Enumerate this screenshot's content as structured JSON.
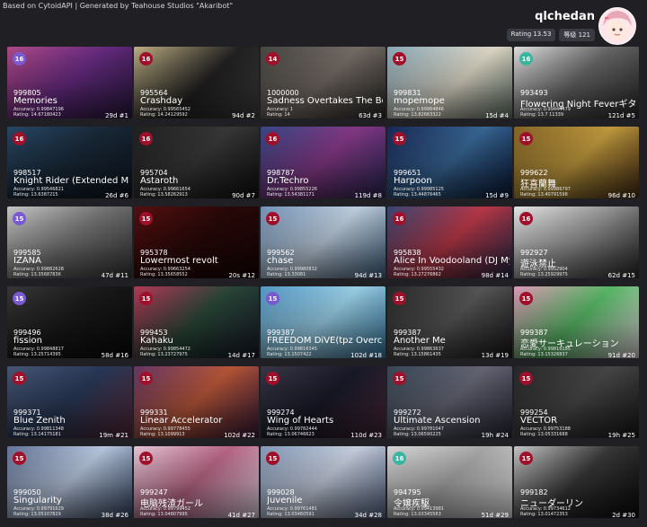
{
  "header": {
    "credit": "Based on CytoidAPI | Generated by Teahouse Studios \"Akaribot\"",
    "username": "qlchedan",
    "rating_label": "Rating 13.53",
    "level_label": "等级 121"
  },
  "colors": {
    "badge_red": "#a0102a",
    "badge_purple": "#7a5ad0",
    "badge_teal": "#38b6a0"
  },
  "cards": [
    {
      "level": "16",
      "lvc": "#7a5ad0",
      "score": "999805",
      "title": "Memories",
      "acc": "Accuracy: 0.99847196",
      "rating": "Rating: 14.67180423",
      "rank": "29d #1",
      "bg": "linear-gradient(135deg,#b84d8c,#6a2c86 50%,#2a1a40)"
    },
    {
      "level": "16",
      "lvc": "#a0102a",
      "score": "995564",
      "title": "Crashday",
      "acc": "Accuracy: 0.99565452",
      "rating": "Rating: 14.24129592",
      "rank": "94d #2",
      "bg": "linear-gradient(135deg,#c7b78a,#222 55%,#444)"
    },
    {
      "level": "14",
      "lvc": "#a0102a",
      "score": "1000000",
      "title": "Sadness Overtakes The Body",
      "acc": "Accuracy: 1",
      "rating": "Rating: 14",
      "rank": "63d #3",
      "bg": "linear-gradient(135deg,#4a4a46,#7a706a 50%,#2d2d2a)"
    },
    {
      "level": "15",
      "lvc": "#a0102a",
      "score": "999831",
      "title": "mopemope",
      "acc": "Accuracy: 0.99964846",
      "rating": "Rating: 13.82663322",
      "rank": "15d #4",
      "bg": "linear-gradient(135deg,#8fb0c0,#e8e2d0 55%,#6a7c70)"
    },
    {
      "level": "16",
      "lvc": "#38b6a0",
      "score": "993493",
      "title": "Flowering Night Feverギターイン",
      "acc": "Accuracy: 0.99444479",
      "rating": "Rating: 13.7 11339",
      "rank": "121d #5",
      "bg": "linear-gradient(135deg,#eaeaea,#6a6a6a 50%,#2a2a2a)"
    },
    {
      "level": "16",
      "lvc": "#a0102a",
      "score": "998517",
      "title": "Knight Rider (Extended Mix)",
      "acc": "Accuracy: 0.99546821",
      "rating": "Rating: 13.6387215",
      "rank": "26d #6",
      "bg": "linear-gradient(135deg,#2a4a6a,#1a2a3a 50%,#0e1620)"
    },
    {
      "level": "16",
      "lvc": "#a0102a",
      "score": "995704",
      "title": "Astaroth",
      "acc": "Accuracy: 0.99661654",
      "rating": "Rating: 13.58262913",
      "rank": "90d #7",
      "bg": "linear-gradient(135deg,#222,#3a3a3a 50%,#111)"
    },
    {
      "level": "16",
      "lvc": "#a0102a",
      "score": "998787",
      "title": "Dr.Techro",
      "acc": "Accuracy: 0.99855226",
      "rating": "Rating: 13.54381171",
      "rank": "119d #8",
      "bg": "linear-gradient(135deg,#3a4a8a,#8a3a8a 50%,#2a2a5a)"
    },
    {
      "level": "15",
      "lvc": "#a0102a",
      "score": "999651",
      "title": "Harpoon",
      "acc": "Accuracy: 0.99985125",
      "rating": "Rating: 13.44876465",
      "rank": "15d #9",
      "bg": "linear-gradient(135deg,#1a2a5a,#3a6a9a 50%,#0a1a3a)"
    },
    {
      "level": "15",
      "lvc": "#a0102a",
      "score": "999622",
      "title": "狂喜蘭舞",
      "acc": "Accuracy: 0.99986797",
      "rating": "Rating: 13.40791598",
      "rank": "96d #10",
      "bg": "linear-gradient(135deg,#8a6a2a,#c8a040 50%,#4a3015)"
    },
    {
      "level": "15",
      "lvc": "#7a5ad0",
      "score": "999585",
      "title": "IZANA",
      "acc": "Accuracy: 0.99882628",
      "rating": "Rating: 13.35687836",
      "rank": "47d #11",
      "bg": "linear-gradient(135deg,#d0d0d0,#7a7a7a 50%,#3a3a3a)"
    },
    {
      "level": "15",
      "lvc": "#a0102a",
      "score": "995378",
      "title": "Lowermost revolt",
      "acc": "Accuracy: 0.99663254",
      "rating": "Rating: 13.35658552",
      "rank": "20s #12",
      "bg": "linear-gradient(135deg,#5a1010,#2a0808 50%,#1a0505)"
    },
    {
      "level": "15",
      "lvc": "#a0102a",
      "score": "999562",
      "title": "chase",
      "acc": "Accuracy: 0.99980832",
      "rating": "Rating: 13.33081",
      "rank": "94d #13",
      "bg": "linear-gradient(135deg,#7a9ac0,#c8d8e8 50%,#4a6a8a)"
    },
    {
      "level": "16",
      "lvc": "#a0102a",
      "score": "995838",
      "title": "Alice In Voodooland (DJ Myosuke",
      "acc": "Accuracy: 0.99555432",
      "rating": "Rating: 13.27276862",
      "rank": "98d #14",
      "bg": "linear-gradient(135deg,#3a4a7a,#c03a4a 50%,#2a2a4a)"
    },
    {
      "level": "16",
      "lvc": "#a0102a",
      "score": "992927",
      "title": "遊泳禁止",
      "acc": "Accuracy: 0.9952904",
      "rating": "Rating: 13.25929975",
      "rank": "62d #15",
      "bg": "linear-gradient(135deg,#f0f0f0,#9a9a9a 50%,#2a2a2a)"
    },
    {
      "level": "15",
      "lvc": "#7a5ad0",
      "score": "999496",
      "title": "fission",
      "acc": "Accuracy: 0.99848817",
      "rating": "Rating: 13.25714395",
      "rank": "58d #16",
      "bg": "linear-gradient(135deg,#3a3a3a,#1a1a1a 50%,#0a0a0a)"
    },
    {
      "level": "15",
      "lvc": "#a0102a",
      "score": "999453",
      "title": "Kahaku",
      "acc": "Accuracy: 0.99854472",
      "rating": "Rating: 13.23727975",
      "rank": "14d #17",
      "bg": "linear-gradient(135deg,#c03a5a,#2a4a3a 50%,#1a1a2a)"
    },
    {
      "level": "15",
      "lvc": "#7a5ad0",
      "score": "999387",
      "title": "FREEDOM DiVE(tpz Overcute Re",
      "acc": "Accuracy: 0.99816345",
      "rating": "Rating: 13.1507422",
      "rank": "102d #18",
      "bg": "linear-gradient(135deg,#5aa0d0,#a0d8f0 50%,#3a7aa0)"
    },
    {
      "level": "15",
      "lvc": "#a0102a",
      "score": "999387",
      "title": "Another Me",
      "acc": "Accuracy: 0.99863637",
      "rating": "Rating: 13.15861435",
      "rank": "13d #19",
      "bg": "linear-gradient(135deg,#2a2a2a,#5a5a5a 50%,#1a1a1a)"
    },
    {
      "level": "15",
      "lvc": "#a0102a",
      "score": "999387",
      "title": "恋愛サーキュレーション",
      "acc": "Accuracy: 0.99816185",
      "rating": "Rating: 13.15326837",
      "rank": "91d #20",
      "bg": "linear-gradient(135deg,#e8a0c0,#5ac06a 50%,#f0e0e8)"
    },
    {
      "level": "15",
      "lvc": "#a0102a",
      "score": "999371",
      "title": "Blue Zenith",
      "acc": "Accuracy: 0.99811348",
      "rating": "Rating: 13.14175181",
      "rank": "19m #21",
      "bg": "linear-gradient(135deg,#4a5a7a,#2a3a5a 50%,#5a2a3a)"
    },
    {
      "level": "15",
      "lvc": "#a0102a",
      "score": "999331",
      "title": "Linear Accelerator",
      "acc": "Accuracy: 0.99778455",
      "rating": "Rating: 13.1099913",
      "rank": "102d #22",
      "bg": "linear-gradient(135deg,#6a3a6a,#c05a3a 50%,#3a1a3a)"
    },
    {
      "level": "15",
      "lvc": "#a0102a",
      "score": "999274",
      "title": "Wing of Hearts",
      "acc": "Accuracy: 0.99782444",
      "rating": "Rating: 13.06746623",
      "rank": "110d #23",
      "bg": "linear-gradient(135deg,#3a3a4a,#1a1a2a 50%,#4a2a3a)"
    },
    {
      "level": "15",
      "lvc": "#a0102a",
      "score": "999272",
      "title": "Ultimate Ascension",
      "acc": "Accuracy: 0.99781047",
      "rating": "Rating: 13.06590225",
      "rank": "19h #24",
      "bg": "linear-gradient(135deg,#3a4a5a,#6a6a7a 50%,#2a2a3a)"
    },
    {
      "level": "15",
      "lvc": "#a0102a",
      "score": "999254",
      "title": "VECTOR",
      "acc": "Accuracy: 0.99753188",
      "rating": "Rating: 13.05331688",
      "rank": "19h #25",
      "bg": "linear-gradient(135deg,#2a2a2a,#4a4a4a 50%,#1a1a1a)"
    },
    {
      "level": "15",
      "lvc": "#a0102a",
      "score": "999050",
      "title": "Singularity",
      "acc": "Accuracy: 0.99791629",
      "rating": "Rating: 13.05107829",
      "rank": "38d #26",
      "bg": "linear-gradient(135deg,#6a7aa0,#c0d0e8 50%,#3a4a6a)"
    },
    {
      "level": "15",
      "lvc": "#a0102a",
      "score": "999247",
      "title": "电脑残渣ガール",
      "acc": "Accuracy: 0.99799452",
      "rating": "Rating: 13.04807995",
      "rank": "41d #27",
      "bg": "linear-gradient(135deg,#f0d0e0,#c06a8a 50%,#f0e0f0)"
    },
    {
      "level": "15",
      "lvc": "#a0102a",
      "score": "999028",
      "title": "Juvenile",
      "acc": "Accuracy: 0.99761481",
      "rating": "Rating: 13.03460591",
      "rank": "34d #28",
      "bg": "linear-gradient(135deg,#8aa0c0,#d0d8e8 50%,#5a6a8a)"
    },
    {
      "level": "16",
      "lvc": "#38b6a0",
      "score": "994795",
      "title": "令嬢疾駆",
      "acc": "Accuracy: 0.99413981",
      "rating": "Rating: 13.03345563",
      "rank": "51d #29",
      "bg": "linear-gradient(135deg,#e0e0e0,#b0b0b0 50%,#f0f0f0)"
    },
    {
      "level": "15",
      "lvc": "#a0102a",
      "score": "999182",
      "title": "ニューダーリン",
      "acc": "Accuracy: 0.99734612",
      "rating": "Rating: 13.01472353",
      "rank": "2d #30",
      "bg": "linear-gradient(135deg,#d0d0d0,#3a3a3a 50%,#0a0a0a)"
    }
  ]
}
